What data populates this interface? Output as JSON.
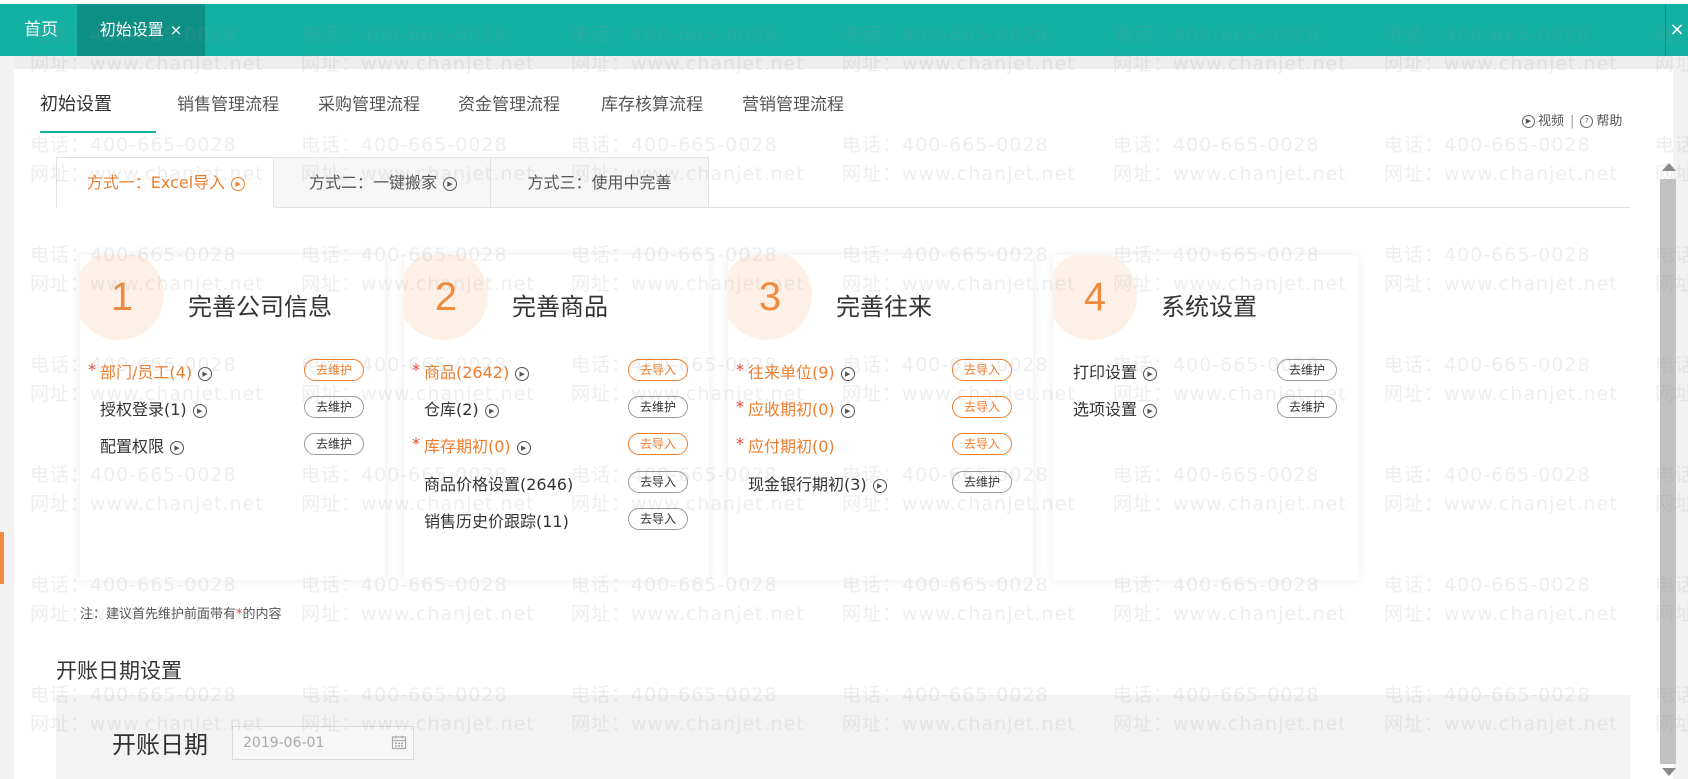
{
  "top_tabs": {
    "home": "首页",
    "active": "初始设置",
    "close": "×",
    "close_all": "×"
  },
  "process_tabs": [
    "初始设置",
    "销售管理流程",
    "采购管理流程",
    "资金管理流程",
    "库存核算流程",
    "营销管理流程"
  ],
  "help": {
    "video": "视频",
    "sep": "|",
    "help": "帮助"
  },
  "method_tabs": [
    "方式一：Excel导入",
    "方式二：一键搬家",
    "方式三：使用中完善"
  ],
  "cards": [
    {
      "num": "1",
      "title": "完善公司信息",
      "rows": [
        {
          "label": "部门/员工(4)",
          "required": true,
          "play": true,
          "button": "去维护",
          "orange": true
        },
        {
          "label": "授权登录(1)",
          "required": false,
          "play": true,
          "button": "去维护",
          "orange": false
        },
        {
          "label": "配置权限",
          "required": false,
          "play": true,
          "button": "去维护",
          "orange": false
        }
      ]
    },
    {
      "num": "2",
      "title": "完善商品",
      "rows": [
        {
          "label": "商品(2642)",
          "required": true,
          "play": true,
          "button": "去导入",
          "orange": true
        },
        {
          "label": "仓库(2)",
          "required": false,
          "play": true,
          "button": "去维护",
          "orange": false
        },
        {
          "label": "库存期初(0)",
          "required": true,
          "play": true,
          "button": "去导入",
          "orange": true
        },
        {
          "label": "商品价格设置(2646)",
          "required": false,
          "play": false,
          "button": "去导入",
          "orange": false
        },
        {
          "label": "销售历史价跟踪(11)",
          "required": false,
          "play": false,
          "button": "去导入",
          "orange": false
        }
      ]
    },
    {
      "num": "3",
      "title": "完善往来",
      "rows": [
        {
          "label": "往来单位(9)",
          "required": true,
          "play": true,
          "button": "去导入",
          "orange": true
        },
        {
          "label": "应收期初(0)",
          "required": true,
          "play": true,
          "button": "去导入",
          "orange": true
        },
        {
          "label": "应付期初(0)",
          "required": true,
          "play": false,
          "button": "去导入",
          "orange": true
        },
        {
          "label": "现金银行期初(3)",
          "required": false,
          "play": true,
          "button": "去维护",
          "orange": false
        }
      ]
    },
    {
      "num": "4",
      "title": "系统设置",
      "rows": [
        {
          "label": "打印设置",
          "required": false,
          "play": true,
          "button": "去维护",
          "orange": false
        },
        {
          "label": "选项设置",
          "required": false,
          "play": true,
          "button": "去维护",
          "orange": false
        }
      ]
    }
  ],
  "note": {
    "prefix": "注：建议首先维护前面带有",
    "star": "*",
    "suffix": "的内容"
  },
  "opening": {
    "section_title": "开账日期设置",
    "label": "开账日期",
    "date": "2019-06-01"
  },
  "watermark": {
    "phone": "电话：400-665-0028",
    "site": "网址：www.chanjet.net"
  },
  "colors": {
    "teal": "#13b1a3",
    "orange": "#ee7d2c",
    "required_star": "#e43"
  }
}
